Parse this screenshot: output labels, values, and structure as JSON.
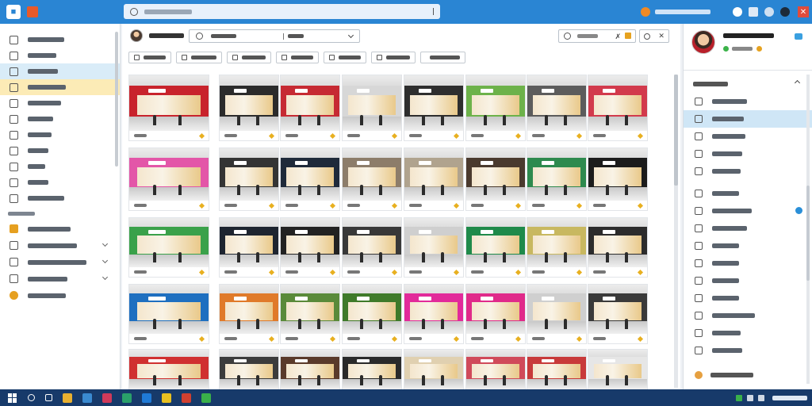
{
  "app": {
    "title": "",
    "search_placeholder": "",
    "user_label": "",
    "accent": "#2a85d3"
  },
  "sidebar": {
    "items": [
      {
        "label": "",
        "icon": "home-icon",
        "state": ""
      },
      {
        "label": "",
        "icon": "image-icon",
        "state": ""
      },
      {
        "label": "",
        "icon": "star-icon",
        "state": "selected"
      },
      {
        "label": "",
        "icon": "store-icon",
        "state": "highlighted"
      },
      {
        "label": "",
        "icon": "document-icon",
        "state": ""
      },
      {
        "label": "",
        "icon": "person-icon",
        "state": ""
      },
      {
        "label": "",
        "icon": "calendar-icon",
        "state": ""
      },
      {
        "label": "",
        "icon": "gear-icon",
        "state": ""
      },
      {
        "label": "",
        "icon": "photo-icon",
        "state": ""
      },
      {
        "label": "",
        "icon": "tag-icon",
        "state": ""
      },
      {
        "label": "",
        "icon": "globe-icon",
        "state": ""
      }
    ],
    "section_label": "",
    "section_items": [
      {
        "label": "",
        "icon": "folder-icon",
        "expandable": false
      },
      {
        "label": "",
        "icon": "settings-icon",
        "expandable": true
      },
      {
        "label": "",
        "icon": "box-icon",
        "expandable": true
      },
      {
        "label": "",
        "icon": "square-icon",
        "expandable": true
      },
      {
        "label": "",
        "icon": "user-circle-icon",
        "expandable": false
      }
    ]
  },
  "toolbar": {
    "title": "",
    "select_value": "",
    "select_secondary": "",
    "search_value": ""
  },
  "filters": [
    {
      "label": ""
    },
    {
      "label": ""
    },
    {
      "label": ""
    },
    {
      "label": ""
    },
    {
      "label": ""
    },
    {
      "label": ""
    },
    {
      "label": ""
    }
  ],
  "gallery": {
    "cards": [
      {
        "caption": "",
        "color": "#c8232c"
      },
      {
        "caption": "",
        "color": "#2b2b2b"
      },
      {
        "caption": "",
        "color": "#c62a33"
      },
      {
        "caption": "",
        "color": "#d7d7d7"
      },
      {
        "caption": "",
        "color": "#2e2e2e"
      },
      {
        "caption": "",
        "color": "#6db24a"
      },
      {
        "caption": "",
        "color": "#5c5c5c"
      },
      {
        "caption": "",
        "color": "#d23a4c"
      },
      {
        "caption": "",
        "color": "#e356a8"
      },
      {
        "caption": "",
        "color": "#343434"
      },
      {
        "caption": "",
        "color": "#1f2a3a"
      },
      {
        "caption": "",
        "color": "#8d7d6a"
      },
      {
        "caption": "",
        "color": "#b0a38e"
      },
      {
        "caption": "",
        "color": "#4a3a2e"
      },
      {
        "caption": "",
        "color": "#2e8a4e"
      },
      {
        "caption": "",
        "color": "#1c1c1c"
      },
      {
        "caption": "",
        "color": "#3aa14a"
      },
      {
        "caption": "",
        "color": "#1e2530"
      },
      {
        "caption": "",
        "color": "#222222"
      },
      {
        "caption": "",
        "color": "#383838"
      },
      {
        "caption": "",
        "color": "#cfcfcf"
      },
      {
        "caption": "",
        "color": "#1f8a4a"
      },
      {
        "caption": "",
        "color": "#c8b860"
      },
      {
        "caption": "",
        "color": "#2c2c2c"
      },
      {
        "caption": "",
        "color": "#1e6fc0"
      },
      {
        "caption": "",
        "color": "#e07a2a"
      },
      {
        "caption": "",
        "color": "#5a8a3a"
      },
      {
        "caption": "",
        "color": "#3f7a2a"
      },
      {
        "caption": "",
        "color": "#e22a9a"
      },
      {
        "caption": "",
        "color": "#e02a8a"
      },
      {
        "caption": "",
        "color": "#cfcfcf"
      },
      {
        "caption": "",
        "color": "#3a3a3a"
      },
      {
        "caption": "",
        "color": "#d03030"
      },
      {
        "caption": "",
        "color": "#3c3c3c"
      },
      {
        "caption": "",
        "color": "#5a3a2a"
      },
      {
        "caption": "",
        "color": "#2a2a2a"
      },
      {
        "caption": "",
        "color": "#e0d0b0"
      },
      {
        "caption": "",
        "color": "#d04a5a"
      },
      {
        "caption": "",
        "color": "#c83a3a"
      },
      {
        "caption": "",
        "color": "#e6e6e6"
      }
    ]
  },
  "right_panel": {
    "profile_name": "",
    "profile_status": "",
    "section_title": "",
    "items": [
      {
        "label": "",
        "icon": "cube-icon",
        "selected": false,
        "badge": false
      },
      {
        "label": "",
        "icon": "calendar-icon",
        "selected": true,
        "badge": false
      },
      {
        "label": "",
        "icon": "card-icon",
        "selected": false,
        "badge": false
      },
      {
        "label": "",
        "icon": "document-icon",
        "selected": false,
        "badge": false
      },
      {
        "label": "",
        "icon": "grid-icon",
        "selected": false,
        "badge": false
      },
      {
        "label": "",
        "icon": "folder-icon",
        "selected": false,
        "badge": false
      },
      {
        "label": "",
        "icon": "square-icon",
        "selected": false,
        "badge": true
      },
      {
        "label": "",
        "icon": "store-icon",
        "selected": false,
        "badge": false
      },
      {
        "label": "",
        "icon": "chart-icon",
        "selected": false,
        "badge": false
      },
      {
        "label": "",
        "icon": "image-icon",
        "selected": false,
        "badge": false
      },
      {
        "label": "",
        "icon": "table-icon",
        "selected": false,
        "badge": false
      },
      {
        "label": "",
        "icon": "clock-icon",
        "selected": false,
        "badge": false
      },
      {
        "label": "",
        "icon": "gear-icon",
        "selected": false,
        "badge": false
      },
      {
        "label": "",
        "icon": "calendar-icon",
        "selected": false,
        "badge": false
      },
      {
        "label": "",
        "icon": "share-icon",
        "selected": false,
        "badge": false
      }
    ],
    "footer_label": ""
  },
  "taskbar": {
    "clock": "",
    "apps": [
      {
        "icon": "search-icon",
        "color": "#ffffff"
      },
      {
        "icon": "task-view-icon",
        "color": "#ffffff"
      },
      {
        "icon": "folder-icon",
        "color": "#e8b030"
      },
      {
        "icon": "store-icon",
        "color": "#3a8ad0"
      },
      {
        "icon": "photos-icon",
        "color": "#d03a5a"
      },
      {
        "icon": "maps-icon",
        "color": "#2aa06a"
      },
      {
        "icon": "edge-icon",
        "color": "#1f7ad6"
      },
      {
        "icon": "mail-icon",
        "color": "#e8c020"
      },
      {
        "icon": "chrome-icon",
        "color": "#d04030"
      },
      {
        "icon": "game-icon",
        "color": "#3ab04a"
      }
    ]
  }
}
